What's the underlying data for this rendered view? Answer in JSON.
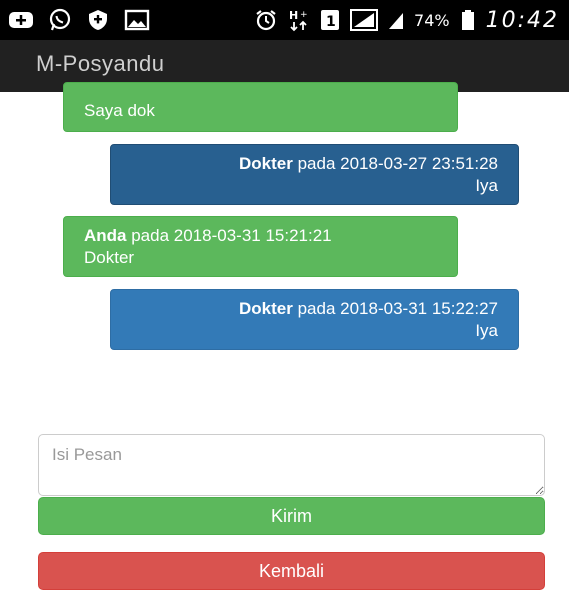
{
  "status_bar": {
    "battery_percent": "74%",
    "clock": "10:42",
    "sim_slot": "1",
    "icons": [
      "add-icon",
      "whatsapp-icon",
      "shield-icon",
      "image-icon",
      "alarm-icon",
      "network-icon",
      "sim-icon",
      "signal-icon",
      "signal-icon",
      "battery-icon"
    ]
  },
  "app": {
    "title": "M-Posyandu"
  },
  "messages": [
    {
      "sender": "",
      "timestamp": "",
      "text": "Saya dok",
      "side": "left"
    },
    {
      "sender": "Dokter",
      "connector": " pada ",
      "timestamp": "2018-03-27 23:51:28",
      "text": "Iya",
      "side": "right"
    },
    {
      "sender": "Anda",
      "connector": " pada ",
      "timestamp": "2018-03-31 15:21:21",
      "text": "Dokter",
      "side": "left"
    },
    {
      "sender": "Dokter",
      "connector": " pada ",
      "timestamp": "2018-03-31 15:22:27",
      "text": "Iya",
      "side": "right"
    }
  ],
  "form": {
    "message_placeholder": "Isi Pesan",
    "message_value": "",
    "send_label": "Kirim",
    "back_label": "Kembali"
  },
  "colors": {
    "success": "#5cb85c",
    "primary": "#337ab7",
    "danger": "#d9534f",
    "app_bar": "#212121"
  }
}
